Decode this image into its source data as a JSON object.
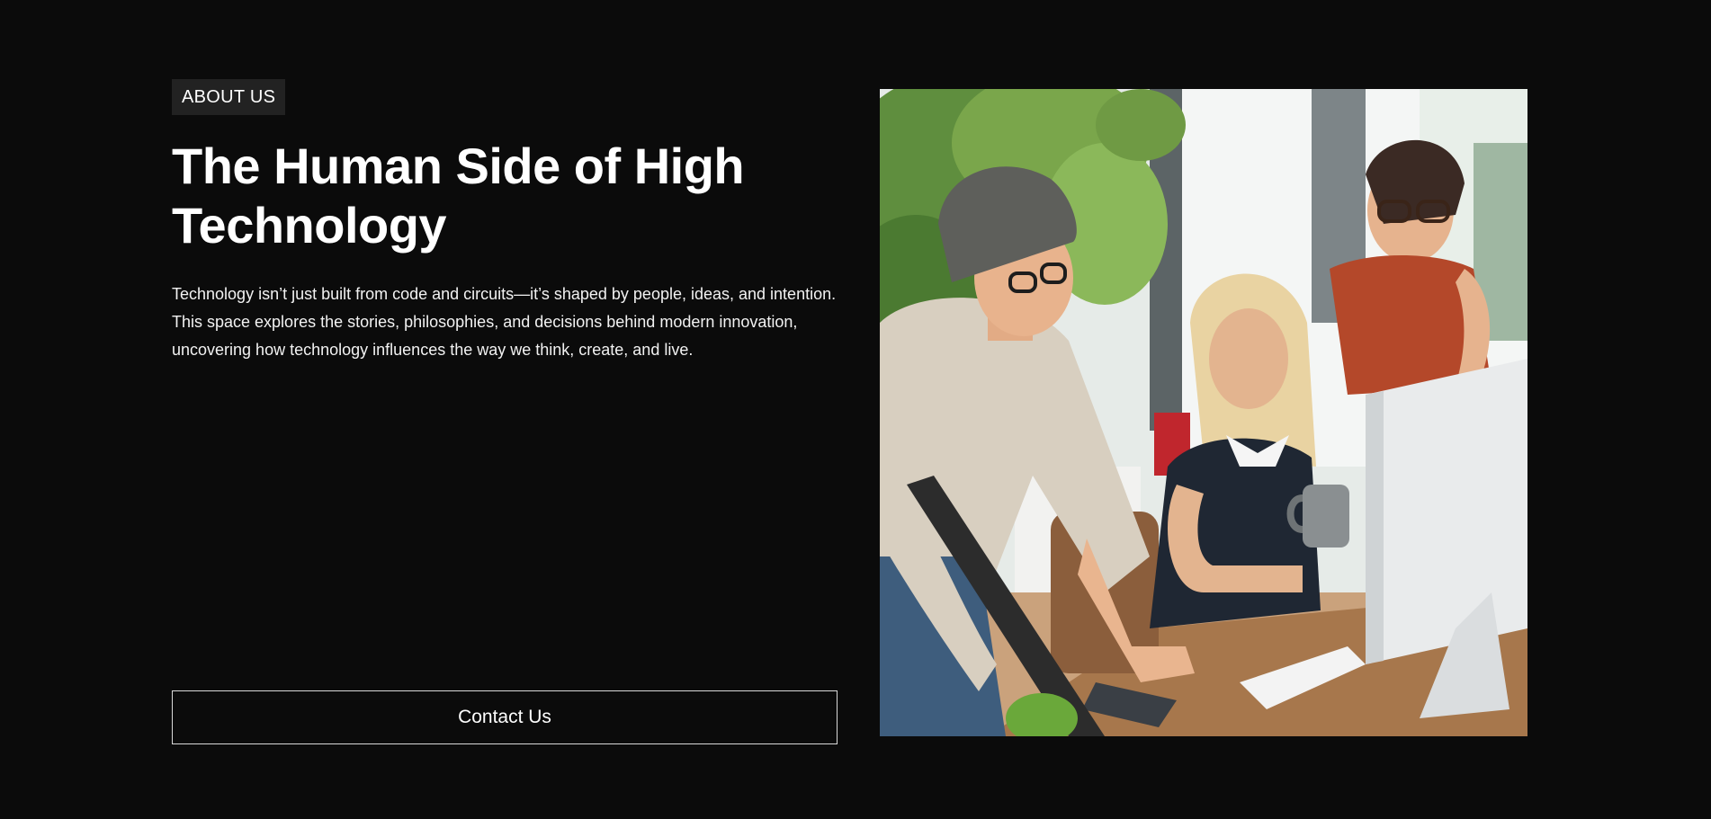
{
  "about": {
    "tag": "ABOUT US",
    "title": "The Human Side of High Technology",
    "description": "Technology isn’t just built from code and circuits—it’s shaped by people, ideas, and intention. This space explores the stories, philosophies, and decisions behind modern innovation, uncovering how technology influences the way we think, create, and live.",
    "contact_label": "Contact Us"
  },
  "colors": {
    "background": "#0b0b0b",
    "tag_background": "#222222",
    "text": "#ffffff",
    "button_border": "#d9d9d9"
  },
  "image": {
    "subject": "three people working together at a desktop computer in a bright office"
  }
}
